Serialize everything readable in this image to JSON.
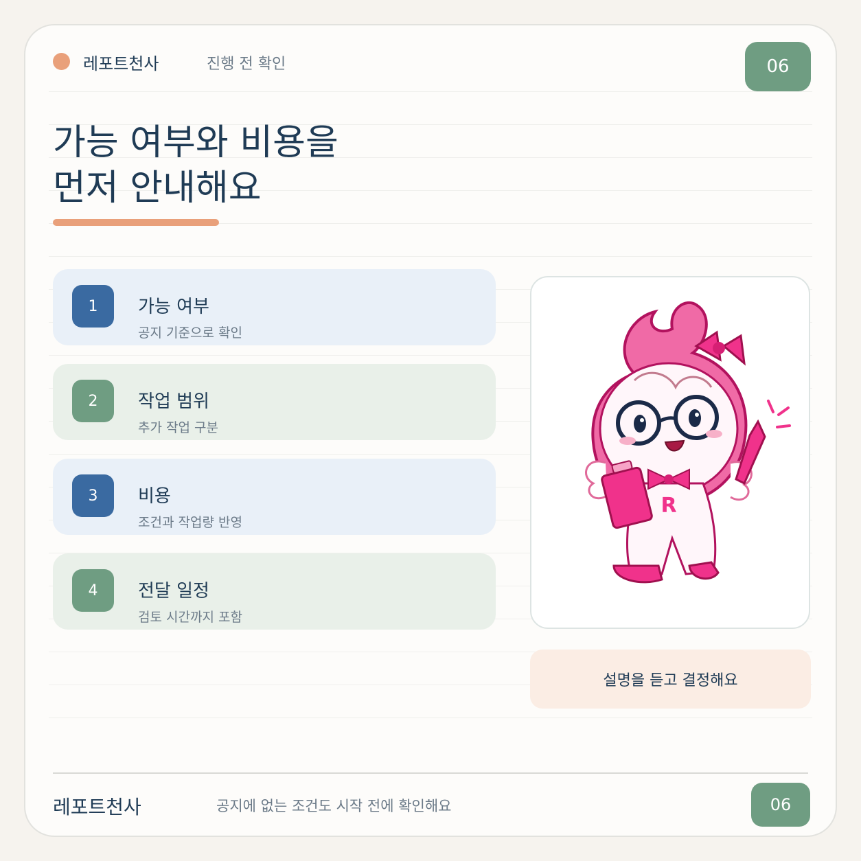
{
  "colors": {
    "accent_orange": "#e9a07a",
    "green": "#6f9d82",
    "blue": "#3a6aa1",
    "blue_bg": "#e9f0f8",
    "green_bg": "#e9f0e9",
    "note_bg": "#fbede4"
  },
  "header": {
    "brand": "레포트천사",
    "step": "진행 전 확인",
    "page_number": "06"
  },
  "title": {
    "line1": "가능 여부와 비용을",
    "line2": "먼저 안내해요"
  },
  "items": [
    {
      "number": "1",
      "title": "가능 여부",
      "desc": "공지 기준으로 확인",
      "tone": "blue"
    },
    {
      "number": "2",
      "title": "작업 범위",
      "desc": "추가 작업 구분",
      "tone": "green"
    },
    {
      "number": "3",
      "title": "비용",
      "desc": "조건과 작업량 반영",
      "tone": "blue"
    },
    {
      "number": "4",
      "title": "전달 일정",
      "desc": "검토 시간까지 포함",
      "tone": "green"
    }
  ],
  "mascot": {
    "icon": "angel-mascot-icon",
    "badge_letter": "R"
  },
  "note": {
    "text": "설명을 듣고 결정해요"
  },
  "footer": {
    "brand": "레포트천사",
    "text": "공지에 없는 조건도 시작 전에 확인해요",
    "page_number": "06"
  }
}
